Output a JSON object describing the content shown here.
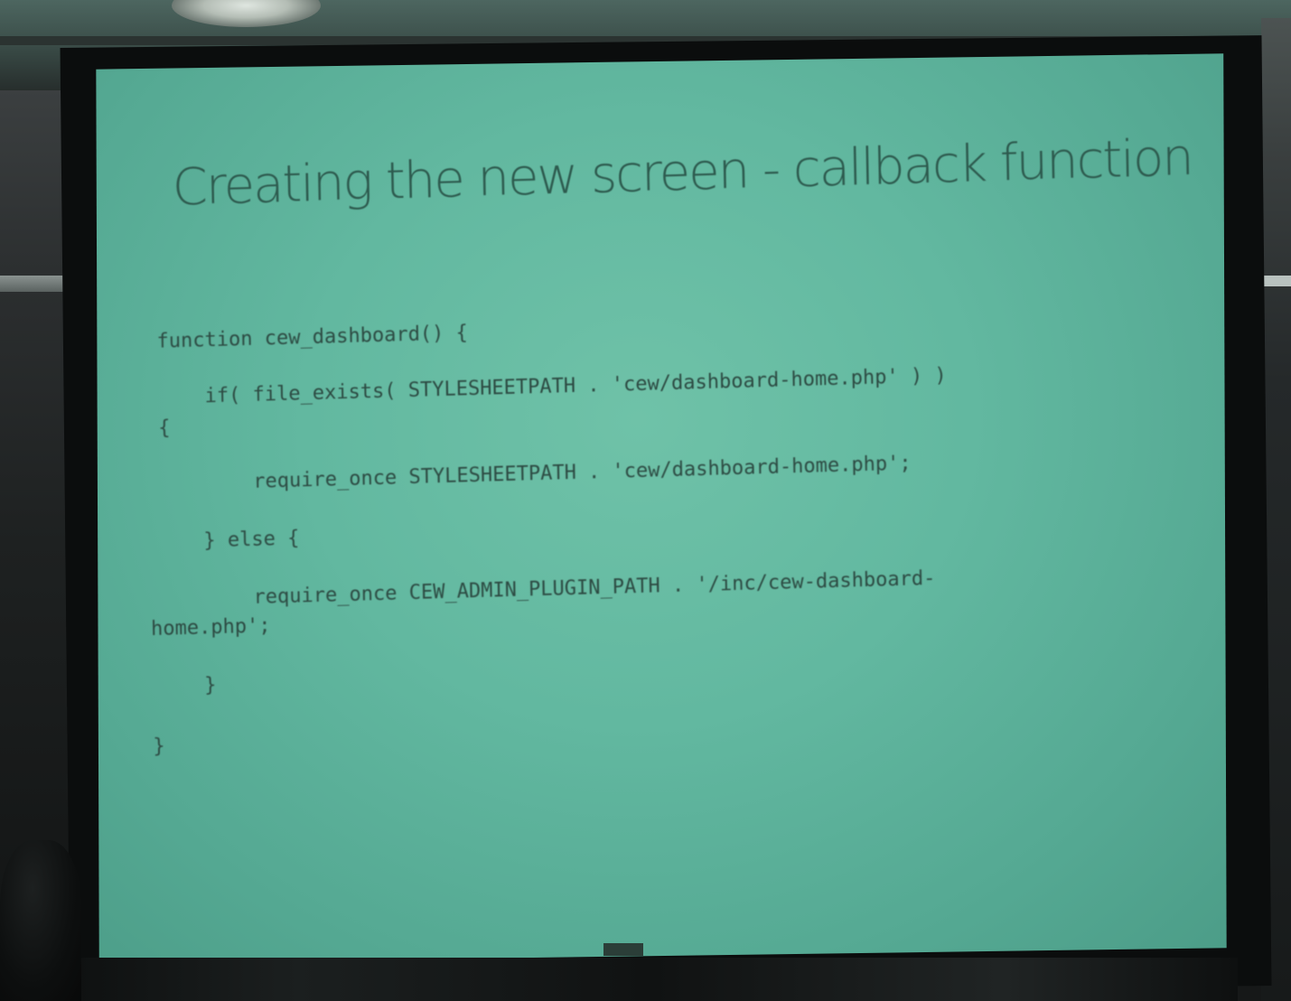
{
  "slide": {
    "title": "Creating the new screen - callback function",
    "code_lines": [
      "function cew_dashboard() {",
      "if( file_exists( STYLESHEETPATH . 'cew/dashboard-home.php' ) )",
      "{",
      "require_once STYLESHEETPATH . 'cew/dashboard-home.php';",
      "} else {",
      "require_once CEW_ADMIN_PLUGIN_PATH . '/inc/cew-dashboard-",
      "home.php';",
      "}",
      "}"
    ]
  },
  "colors": {
    "screen_background": "#62b8a0",
    "title_text": "#2d5a4e",
    "code_text": "#2c4a42"
  }
}
